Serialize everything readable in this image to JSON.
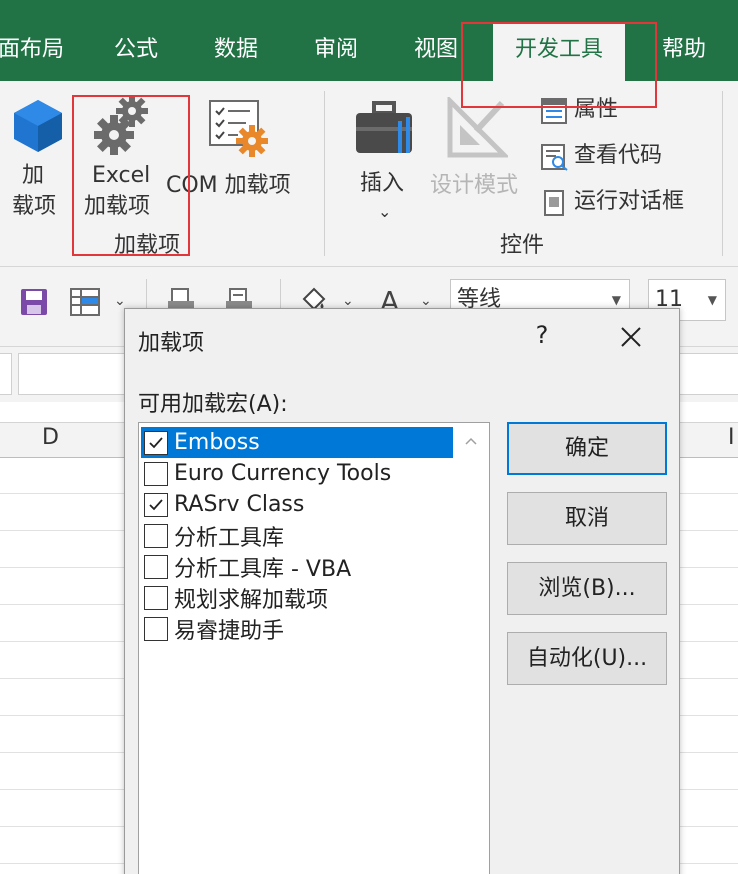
{
  "ribbon_tabs": {
    "page_layout": "面布局",
    "formulas": "公式",
    "data": "数据",
    "review": "审阅",
    "view": "视图",
    "developer": "开发工具",
    "help": "帮助"
  },
  "ribbon": {
    "addins_group": {
      "label": "加载项",
      "addins_button_line1": "加",
      "addins_button_line2": "载项",
      "excel_addins_line1": "Excel",
      "excel_addins_line2": "加载项",
      "com_addins": "COM 加载项"
    },
    "controls_group": {
      "label": "控件",
      "insert": "插入",
      "insert_arrow": "⌄",
      "design_mode": "设计模式",
      "properties": "属性",
      "view_code": "查看代码",
      "run_dialog": "运行对话框"
    }
  },
  "quick_toolbar": {
    "font_name": "等线",
    "font_size": "11",
    "font_letter": "A"
  },
  "sheet": {
    "col_d": "D",
    "col_i": "I"
  },
  "dialog": {
    "title": "加载项",
    "help": "?",
    "list_label": "可用加载宏(A):",
    "addins": [
      {
        "label": "Emboss",
        "checked": true,
        "selected": true
      },
      {
        "label": "Euro Currency Tools",
        "checked": false,
        "selected": false
      },
      {
        "label": "RASrv Class",
        "checked": true,
        "selected": false
      },
      {
        "label": "分析工具库",
        "checked": false,
        "selected": false
      },
      {
        "label": "分析工具库 - VBA",
        "checked": false,
        "selected": false
      },
      {
        "label": "规划求解加载项",
        "checked": false,
        "selected": false
      },
      {
        "label": "易睿捷助手",
        "checked": false,
        "selected": false
      }
    ],
    "buttons": {
      "ok": "确定",
      "cancel": "取消",
      "browse": "浏览(B)...",
      "automation": "自动化(U)..."
    }
  },
  "colors": {
    "excel_green": "#217346",
    "ribbon_bg": "#f3f3f3",
    "selection_blue": "#0078d7",
    "highlight_red": "#e2373a"
  }
}
